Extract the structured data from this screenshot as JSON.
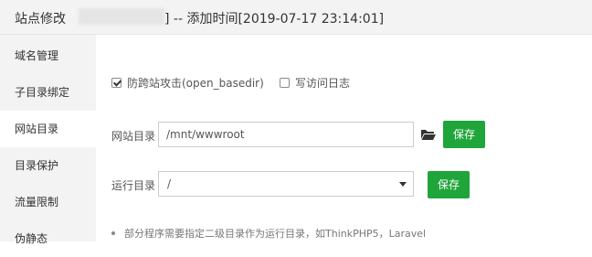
{
  "header": {
    "title_prefix": "站点修改",
    "title_suffix": "] -- 添加时间[2019-07-17 23:14:01]"
  },
  "sidebar": {
    "items": [
      {
        "label": "域名管理"
      },
      {
        "label": "子目录绑定"
      },
      {
        "label": "网站目录"
      },
      {
        "label": "目录保护"
      },
      {
        "label": "流量限制"
      },
      {
        "label": "伪静态"
      }
    ],
    "active_index": 2
  },
  "main": {
    "anti_xss": {
      "label": "防跨站攻击(open_basedir)",
      "checked": true
    },
    "access_log": {
      "label": "写访问日志",
      "checked": false
    },
    "site_dir": {
      "label": "网站目录",
      "value": "/mnt/wwwroot",
      "save_label": "保存"
    },
    "run_dir": {
      "label": "运行目录",
      "selected": "/",
      "save_label": "保存"
    },
    "note": "部分程序需要指定二级目录作为运行目录，如ThinkPHP5，Laravel"
  },
  "colors": {
    "accent": "#20a53a",
    "sidebar_bg": "#f3f3f3"
  }
}
